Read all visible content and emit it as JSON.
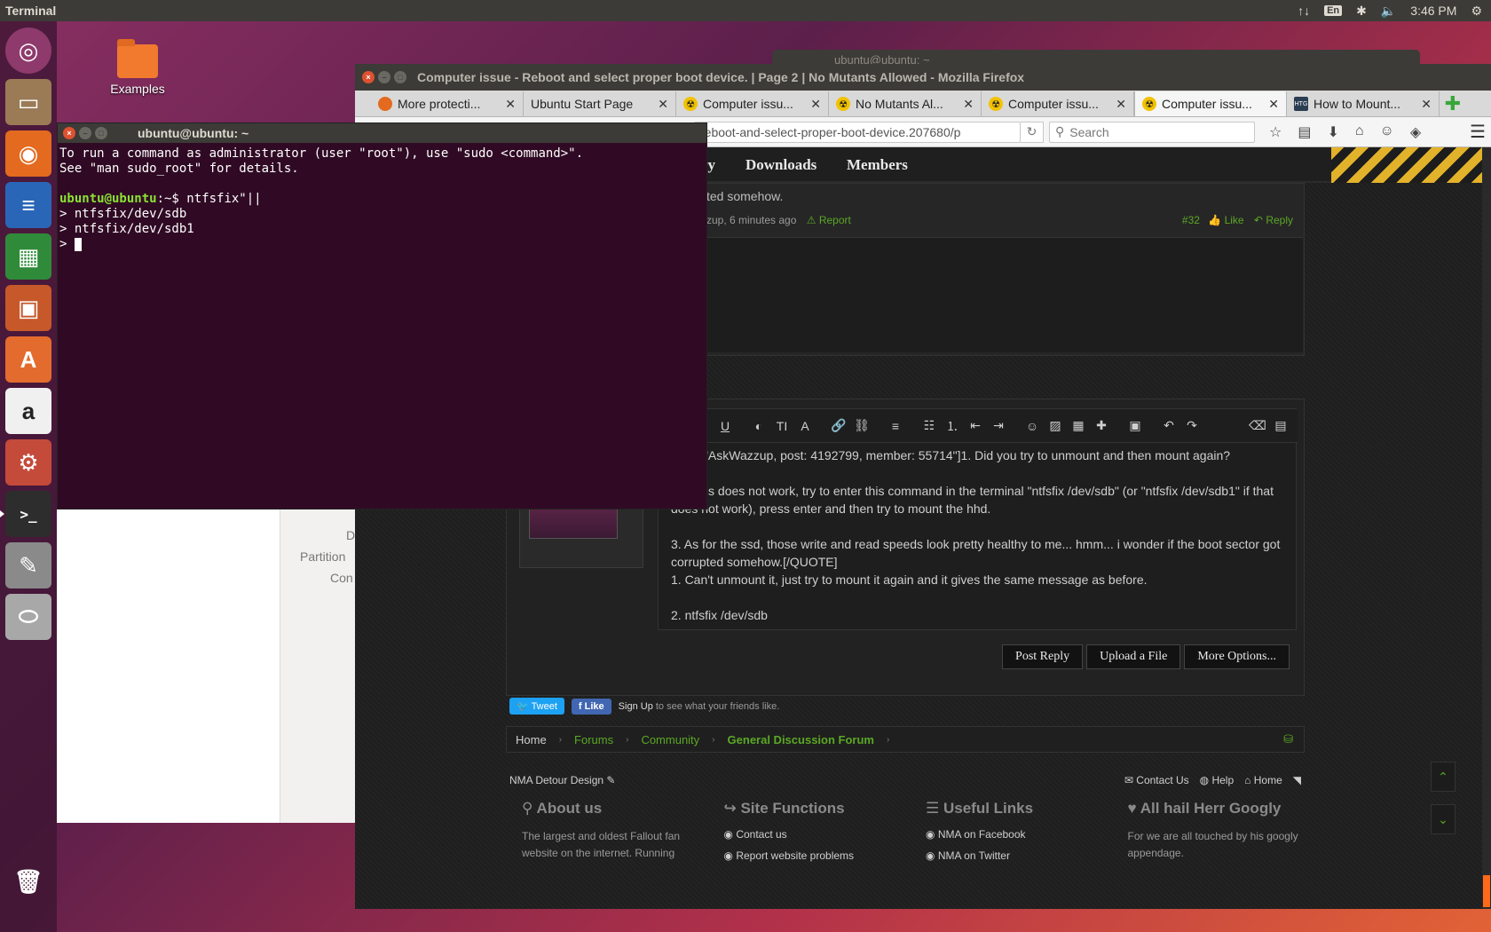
{
  "top_panel": {
    "app_title": "Terminal",
    "indicators": [
      "↑↓",
      "En",
      "✱",
      "🔈",
      "3:46 PM",
      "⚙"
    ]
  },
  "launcher": {
    "items": [
      {
        "name": "ubuntu-dash",
        "glyph": "◎"
      },
      {
        "name": "files",
        "glyph": "▭"
      },
      {
        "name": "firefox",
        "glyph": "◉"
      },
      {
        "name": "writer",
        "glyph": "≡"
      },
      {
        "name": "calc",
        "glyph": "▦"
      },
      {
        "name": "impress",
        "glyph": "▣"
      },
      {
        "name": "software-center",
        "glyph": "A"
      },
      {
        "name": "amazon",
        "glyph": "a"
      },
      {
        "name": "system-settings",
        "glyph": "⚙"
      },
      {
        "name": "terminal",
        "glyph": ">_"
      },
      {
        "name": "tools",
        "glyph": "✎"
      },
      {
        "name": "disks",
        "glyph": "⬭"
      },
      {
        "name": "trash",
        "glyph": "🗑"
      }
    ]
  },
  "desktop": {
    "examples_label": "Examples"
  },
  "bg_window": {
    "title": "ubuntu@ubuntu: ~"
  },
  "disks": {
    "label1": "D",
    "label2": "Partition",
    "label3": "Con"
  },
  "firefox": {
    "title": "Computer issue - Reboot and select proper boot device. | Page 2 | No Mutants Allowed - Mozilla Firefox",
    "tabs": [
      {
        "label": "More protecti...",
        "icon": "ff"
      },
      {
        "label": "Ubuntu Start Page",
        "icon": ""
      },
      {
        "label": "Computer issu...",
        "icon": "nma"
      },
      {
        "label": "No Mutants Al...",
        "icon": "nma"
      },
      {
        "label": "Computer issu...",
        "icon": "nma"
      },
      {
        "label": "Computer issu...",
        "icon": "nma"
      },
      {
        "label": "How to Mount...",
        "icon": "htg"
      }
    ],
    "url": "reboot-and-select-proper-boot-device.207680/p",
    "search_placeholder": "Search"
  },
  "page": {
    "nav": {
      "item1": "ry",
      "downloads": "Downloads",
      "members": "Members"
    },
    "prev_post": {
      "text": "ted somehow.",
      "meta": "zup, 6 minutes ago",
      "report": "Report",
      "number": "#32",
      "like": "Like",
      "reply": "Reply"
    },
    "editor": {
      "para1": "OTE=\"AskWazzup, post: 4192799, member: 55714\"]1. Did you try to unmount and then mount again?",
      "para2": "2. If this does not work, try to enter this command in the terminal \"ntfsfix /dev/sdb\" (or \"ntfsfix /dev/sdb1\"  if that does not work), press enter and then try to mount the hhd.",
      "para3": "3. As for the ssd, those write and read speeds look pretty healthy to me... hmm... i wonder if the boot sector got corrupted somehow.[/QUOTE]",
      "para4": "1. Can't unmount it, just try to mount it again and it gives the same message as before.",
      "para5": "2. ntfsfix /dev/sdb"
    },
    "buttons": {
      "post_reply": "Post Reply",
      "upload": "Upload a File",
      "more": "More Options..."
    },
    "social": {
      "tweet": "Tweet",
      "like": "Like",
      "signup": "Sign Up",
      "signup_rest": "to see what your friends like."
    },
    "breadcrumb": {
      "home": "Home",
      "forums": "Forums",
      "community": "Community",
      "gdf": "General Discussion Forum"
    },
    "footer": {
      "design": "NMA Detour Design",
      "contact": "Contact Us",
      "help": "Help",
      "home": "Home",
      "about_title": "About us",
      "about_text": "The largest and oldest Fallout fan website on the internet. Running",
      "site_title": "Site Functions",
      "site_link1": "Contact us",
      "site_link2": "Report website problems",
      "useful_title": "Useful Links",
      "useful_link1": "NMA on Facebook",
      "useful_link2": "NMA on Twitter",
      "hail_title": "All hail Herr Googly",
      "hail_text": "For we are all touched by his googly appendage."
    }
  },
  "terminal": {
    "title": "ubuntu@ubuntu: ~",
    "line1": "To run a command as administrator (user \"root\"), use \"sudo <command>\".",
    "line2": "See \"man sudo_root\" for details.",
    "prompt": "ubuntu@ubuntu",
    "prompt_suffix": ":~$",
    "command": " ntfsfix\"||",
    "line4": "> ntfsfix/dev/sdb",
    "line5": "> ntfsfix/dev/sdb1",
    "line6": "> "
  }
}
